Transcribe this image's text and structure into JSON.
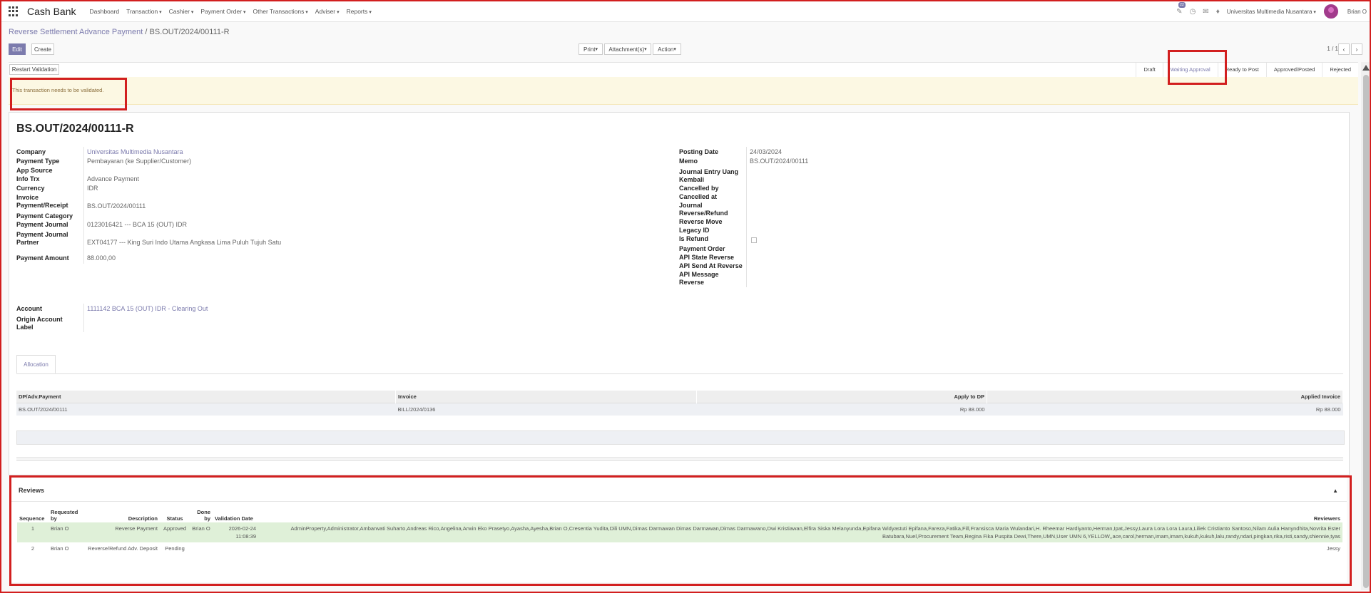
{
  "navbar": {
    "brand": "Cash Bank",
    "menu": [
      "Dashboard",
      "Transaction",
      "Cashier",
      "Payment Order",
      "Other Transactions",
      "Adviser",
      "Reports"
    ],
    "badge": "22",
    "company": "Universitas Multimedia Nusantara",
    "user": "Brian O"
  },
  "breadcrumb": {
    "parent": "Reverse Settlement Advance Payment",
    "current": "BS.OUT/2024/00111-R"
  },
  "buttons": {
    "edit": "Edit",
    "create": "Create",
    "print": "Print",
    "attachments": "Attachment(s)",
    "action": "Action",
    "restart": "Restart Validation"
  },
  "pager": "1 / 1",
  "stages": [
    "Draft",
    "Waiting Approval",
    "Ready to Post",
    "Approved/Posted",
    "Rejected"
  ],
  "active_stage": "Waiting Approval",
  "alert": "This transaction needs to be validated.",
  "record": {
    "title": "BS.OUT/2024/00111-R",
    "left": [
      {
        "label": "Company",
        "value": "Universitas Multimedia Nusantara"
      },
      {
        "label": "Payment Type",
        "value": "Pembayaran (ke Supplier/Customer)"
      },
      {
        "label": "App Source",
        "value": ""
      },
      {
        "label": "Info Trx",
        "value": "Advance Payment"
      },
      {
        "label": "Currency",
        "value": "IDR"
      },
      {
        "label": "Invoice Payment/Receipt",
        "value": "BS.OUT/2024/00111"
      },
      {
        "label": "Payment Category",
        "value": ""
      },
      {
        "label": "Payment Journal",
        "value": "0123016421 --- BCA 15 (OUT) IDR"
      },
      {
        "label": "Payment Journal Partner",
        "value": "EXT04177 --- King Suri Indo Utama Angkasa Lima Puluh Tujuh Satu"
      },
      {
        "label": "Payment Amount",
        "value": "88.000,00"
      }
    ],
    "right": [
      {
        "label": "Posting Date",
        "value": "24/03/2024"
      },
      {
        "label": "Memo",
        "value": "BS.OUT/2024/00111"
      },
      {
        "label": "Journal Entry Uang Kembali",
        "value": ""
      },
      {
        "label": "Cancelled by",
        "value": ""
      },
      {
        "label": "Cancelled at",
        "value": ""
      },
      {
        "label": "Journal Reverse/Refund",
        "value": ""
      },
      {
        "label": "Reverse Move",
        "value": ""
      },
      {
        "label": "Legacy ID",
        "value": ""
      },
      {
        "label": "Is Refund",
        "value": ""
      },
      {
        "label": "Payment Order",
        "value": ""
      },
      {
        "label": "API State Reverse",
        "value": ""
      },
      {
        "label": "API Send At Reverse",
        "value": ""
      },
      {
        "label": "API Message Reverse",
        "value": ""
      }
    ],
    "account_label": "Account",
    "account_value": "1111142 BCA 15 (OUT) IDR - Clearing Out",
    "origin_label": "Origin Account Label"
  },
  "tab": "Allocation",
  "allocation": {
    "headers": [
      "DP/Adv.Payment",
      "Invoice",
      "Apply to DP",
      "Applied Invoice"
    ],
    "rows": [
      [
        "BS.OUT/2024/00111",
        "BILL/2024/0136",
        "Rp 88.000",
        "Rp 88.000"
      ]
    ]
  },
  "reviews": {
    "title": "Reviews",
    "headers": [
      "Sequence",
      "Requested by",
      "Description",
      "Status",
      "Done by",
      "Validation Date",
      "Reviewers"
    ],
    "rows": [
      {
        "seq": "1",
        "requested": "Brian O",
        "desc": "Reverse Payment",
        "status": "Approved",
        "done": "Brian O",
        "date": "2026-02-24 11:08:39",
        "reviewers": "AdminProperty,Administrator,Ambarwati Suharto,Andreas Rico,Angelina,Arwin Eko Prasetyo,Ayasha,Ayesha,Brian O,Cresentia Yudita,Dili UMN,Dimas Darmawan Dimas Darmawan,Dimas Darmawano,Dwi Kristiawan,Elfira Siska Melanyunda,Epifana Widyastuti Epifana,Fareza,Fatika,Fill,Fransisca Maria Wulandari,H. Rheemar Hardiyanto,Herman,Ipat,Jessy,Laura Lora Lora Laura,Liliek Cristianto Santoso,Nilam Aulia Hanyndhita,Novrita Ester Batubara,Nuel,Procurement Team,Regina Fika Puspita Dewi,There,UMN,User UMN 6,YELLOW,,ace,carol,herman,imam,imam,kukuh,kukuh,lalu,randy,ndari,pingkan,rika,risti,sandy,shiennie,tyas"
      },
      {
        "seq": "2",
        "requested": "Brian O",
        "desc": "Reverse/Refund Adv. Deposit",
        "status": "Pending",
        "done": "",
        "date": "",
        "reviewers": "Jessy"
      }
    ]
  }
}
